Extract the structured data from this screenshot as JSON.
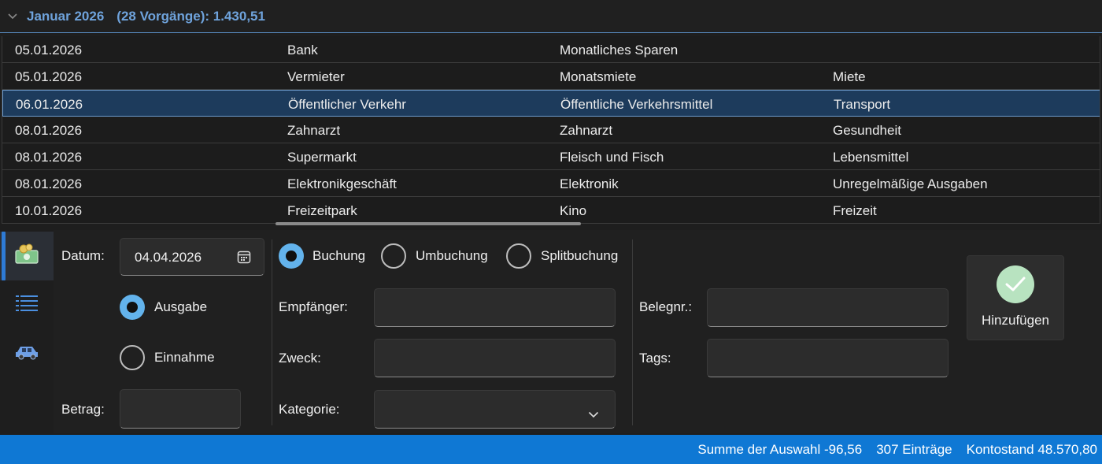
{
  "group": {
    "title": "Januar 2026",
    "summary": "(28 Vorgänge): 1.430,51"
  },
  "rows": [
    {
      "date": "05.01.2026",
      "payee": "Bank",
      "purpose": "Monatliches Sparen",
      "category": ""
    },
    {
      "date": "05.01.2026",
      "payee": "Vermieter",
      "purpose": "Monatsmiete",
      "category": "Miete"
    },
    {
      "date": "06.01.2026",
      "payee": "Öffentlicher Verkehr",
      "purpose": "Öffentliche Verkehrsmittel",
      "category": "Transport"
    },
    {
      "date": "08.01.2026",
      "payee": "Zahnarzt",
      "purpose": "Zahnarzt",
      "category": "Gesundheit"
    },
    {
      "date": "08.01.2026",
      "payee": "Supermarkt",
      "purpose": "Fleisch und Fisch",
      "category": "Lebensmittel"
    },
    {
      "date": "08.01.2026",
      "payee": "Elektronikgeschäft",
      "purpose": "Elektronik",
      "category": "Unregelmäßige Ausgaben"
    },
    {
      "date": "10.01.2026",
      "payee": "Freizeitpark",
      "purpose": "Kino",
      "category": "Freizeit"
    }
  ],
  "nav": {
    "items": [
      "money-icon",
      "list-icon",
      "car-icon"
    ]
  },
  "form": {
    "date_label": "Datum:",
    "date_value": "04.04.2026",
    "expense_label": "Ausgabe",
    "income_label": "Einnahme",
    "amount_label": "Betrag:",
    "amount_value": "",
    "booking_label": "Buchung",
    "transfer_label": "Umbuchung",
    "split_label": "Splitbuchung",
    "payee_label": "Empfänger:",
    "payee_value": "",
    "purpose_label": "Zweck:",
    "purpose_value": "",
    "category_label": "Kategorie:",
    "category_value": "",
    "receipt_label": "Belegnr.:",
    "receipt_value": "",
    "tags_label": "Tags:",
    "tags_value": "",
    "add_label": "Hinzufügen"
  },
  "status": {
    "selection_sum": "Summe der Auswahl -96,56",
    "entries": "307 Einträge",
    "balance": "Kontostand 48.570,80"
  },
  "colors": {
    "accent": "#0f78d4",
    "selected_row": "#1d3b5c",
    "group_header_text": "#6fa3dc",
    "radio_checked": "#63b3ec",
    "add_check": "#b8e3c0"
  }
}
